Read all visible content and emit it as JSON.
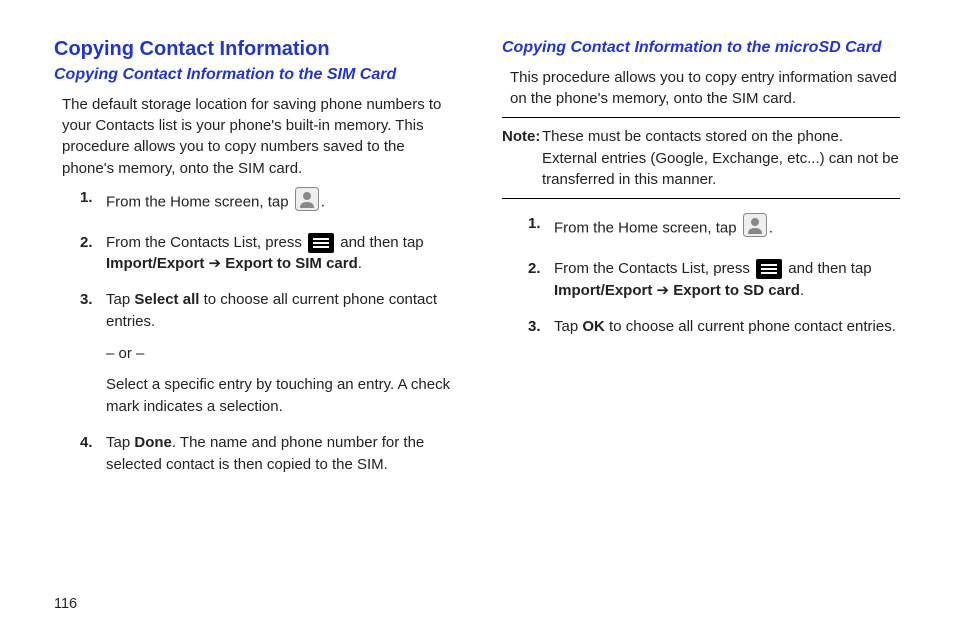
{
  "pageNumber": "116",
  "left": {
    "h2": "Copying Contact Information",
    "h3": "Copying Contact Information to the SIM Card",
    "intro": "The default storage location for saving phone numbers to your Contacts list is your phone's built-in memory. This procedure allows you to copy numbers saved to the phone's memory, onto the SIM card.",
    "step1_a": "From the Home screen, tap ",
    "step1_b": ".",
    "step2_a": "From the Contacts List, press ",
    "step2_b": " and then tap ",
    "step2_c": "Import/Export",
    "step2_arrow": " ➔ ",
    "step2_d": "Export to SIM card",
    "step2_e": ".",
    "step3_a": "Tap ",
    "step3_b": "Select all",
    "step3_c": " to choose all current phone contact entries.",
    "step3_or": "– or –",
    "step3_alt": "Select a specific entry by touching an entry. A check mark indicates a selection.",
    "step4_a": "Tap ",
    "step4_b": "Done",
    "step4_c": ". The name and phone number for the selected contact is then copied to the SIM."
  },
  "right": {
    "h3": "Copying Contact Information to the microSD Card",
    "intro": "This procedure allows you to copy entry information saved on the phone's memory, onto the SIM card.",
    "note_label": "Note:",
    "note_body": " These must be contacts stored on the phone. External entries (Google, Exchange, etc...) can not be transferred in this manner.",
    "step1_a": "From the Home screen, tap ",
    "step1_b": ".",
    "step2_a": "From the Contacts List, press ",
    "step2_b": " and then tap ",
    "step2_c": "Import/Export",
    "step2_arrow": " ➔ ",
    "step2_d": "Export to SD card",
    "step2_e": ".",
    "step3_a": "Tap ",
    "step3_b": "OK",
    "step3_c": " to choose all current phone contact entries."
  }
}
